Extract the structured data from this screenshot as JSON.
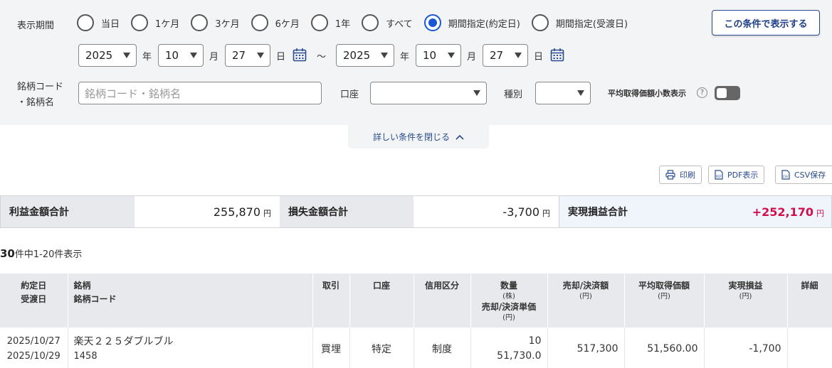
{
  "filter": {
    "period_label": "表示期間",
    "period_options": [
      {
        "label": "当日",
        "checked": false
      },
      {
        "label": "1ケ月",
        "checked": false
      },
      {
        "label": "3ケ月",
        "checked": false
      },
      {
        "label": "6ケ月",
        "checked": false
      },
      {
        "label": "1年",
        "checked": false
      },
      {
        "label": "すべて",
        "checked": false
      },
      {
        "label": "期間指定(約定日)",
        "checked": true
      },
      {
        "label": "期間指定(受渡日)",
        "checked": false
      }
    ],
    "show_button": "この条件で表示する",
    "date_from": {
      "year": "2025",
      "month": "10",
      "day": "27"
    },
    "date_to": {
      "year": "2025",
      "month": "10",
      "day": "27"
    },
    "unit_year": "年",
    "unit_month": "月",
    "unit_day": "日",
    "range_sep": "〜",
    "code_label_1": "銘柄コード",
    "code_label_2": "・銘柄名",
    "code_placeholder": "銘柄コード・銘柄名",
    "account_label": "口座",
    "account_value": "",
    "type_label": "種別",
    "type_value": "",
    "avg_decimal_label": "平均取得価額小数表示",
    "avg_decimal_on": false,
    "collapse_label": "詳しい条件を閉じる"
  },
  "toolbar": {
    "print": "印刷",
    "pdf": "PDF表示",
    "csv": "CSV保存"
  },
  "summary": {
    "profit_label": "利益金額合計",
    "profit_value": "255,870",
    "loss_label": "損失金額合計",
    "loss_value": "-3,700",
    "realized_label": "実現損益合計",
    "realized_value": "+252,170",
    "yen": "円"
  },
  "count": {
    "total": "30",
    "text": "件中1-20件表示"
  },
  "table": {
    "headers": {
      "date1": "約定日",
      "date2": "受渡日",
      "name1": "銘柄",
      "name2": "銘柄コード",
      "trade": "取引",
      "account": "口座",
      "credit": "信用区分",
      "qty": "数量",
      "qty_unit": "(株)",
      "unit_price": "売却/決済単価",
      "unit_price_unit": "(円)",
      "amount": "売却/決済額",
      "amount_unit": "(円)",
      "avg": "平均取得価額",
      "avg_unit": "(円)",
      "pl": "実現損益",
      "pl_unit": "(円)",
      "detail": "詳細"
    },
    "rows": [
      {
        "trade_date": "2025/10/27",
        "settle_date": "2025/10/29",
        "name": "楽天２２５ダブルブル",
        "code": "1458",
        "trade": "買埋",
        "account": "特定",
        "credit": "制度",
        "qty": "10",
        "unit_price": "51,730.0",
        "amount": "517,300",
        "avg": "51,560.00",
        "pl": "-1,700"
      }
    ]
  },
  "colors": {
    "accent": "#1a56d6",
    "button_border": "#2a4a8e",
    "profit": "#d0104c",
    "loss": "#1e8a2e",
    "panel_bg": "#f3f4f6"
  }
}
